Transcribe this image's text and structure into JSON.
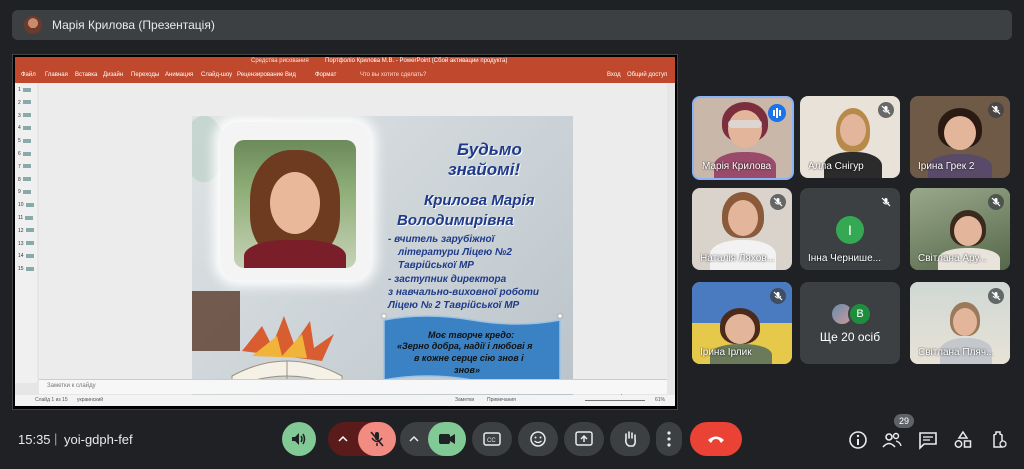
{
  "presenter": {
    "title": "Марія Крилова (Презентація)"
  },
  "powerpoint": {
    "title": "Портфоліо Крилова М.В. - PowerPoint (Сбой активации продукта)",
    "context_tab": "Средства рисования",
    "menu": [
      "Файл",
      "Главная",
      "Вставка",
      "Дизайн",
      "Переходы",
      "Анимация",
      "Слайд-шоу",
      "Рецензирование",
      "Вид",
      "Формат"
    ],
    "search": "Что вы хотите сделать?",
    "share": "Общий доступ",
    "account": "Вход",
    "notes_placeholder": "Заметки к слайду",
    "status_left": "Слайд 1 из 15",
    "status_lang": "украинский",
    "status_notes": "Заметки",
    "status_comments": "Примечания",
    "zoom": "61%",
    "thumbnails": [
      "1",
      "2",
      "3",
      "4",
      "5",
      "6",
      "7",
      "8",
      "9",
      "10",
      "11",
      "12",
      "13",
      "14",
      "15"
    ]
  },
  "slide": {
    "heading_line1": "Будьмо",
    "heading_line2": "знайомі!",
    "name_line1": "Крилова Марія",
    "name_line2": "Володимирівна",
    "bullets": [
      "-   вчитель зарубіжної",
      "літератури  Ліцею №2",
      "Таврійської МР",
      "- заступник директора",
      "з навчально-виховної роботи",
      "Ліцею № 2 Таврійської МР"
    ],
    "credo": [
      "Моє творче кредо:",
      "«Зерно добра, надії і любові я",
      "в кожне серце сію знов і",
      "знов»"
    ]
  },
  "participants": [
    {
      "name": "Марія Крилова",
      "muted": false,
      "speaking": true
    },
    {
      "name": "Алла Снігур",
      "muted": true
    },
    {
      "name": "Ірина Грек 2",
      "muted": true
    },
    {
      "name": "Наталія Ляхов...",
      "muted": true
    },
    {
      "name": "Інна Чернише...",
      "muted": true,
      "avatar_letter": "І"
    },
    {
      "name": "Світлана Ару...",
      "muted": true
    },
    {
      "name": "Ірина Ірлик",
      "muted": true
    },
    {
      "name": "Ще 20 осіб",
      "avatar_letter": "B"
    },
    {
      "name": "Світлана Пляч...",
      "muted": true
    }
  ],
  "bottom": {
    "time": "15:35",
    "separator": "|",
    "meeting_code": "yoi-gdph-fef",
    "participant_count": "29"
  },
  "colors": {
    "background": "#202124",
    "ppt_accent": "#c0482c",
    "slide_text": "#1e3a8a",
    "leave": "#ea4335",
    "active_green": "#81c995",
    "mic_off": "#f28b82"
  }
}
